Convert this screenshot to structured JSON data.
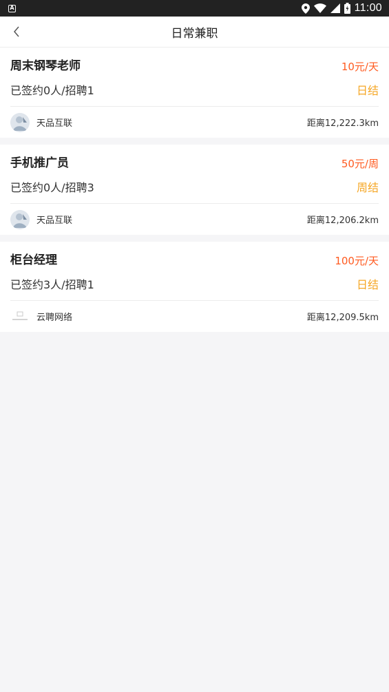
{
  "status_bar": {
    "time": "11:00",
    "left_icon": "a-notification-icon",
    "icons": [
      "location-icon",
      "wifi-icon",
      "signal-icon",
      "battery-icon"
    ]
  },
  "nav": {
    "title": "日常兼职",
    "back_icon": "chevron-left-icon"
  },
  "jobs": [
    {
      "title": "周末钢琴老师",
      "pay": "10元/天",
      "signed": "已签约0人/招聘1",
      "settle": "日结",
      "company": "天品互联",
      "distance": "距离12,222.3km"
    },
    {
      "title": "手机推广员",
      "pay": "50元/周",
      "signed": "已签约0人/招聘3",
      "settle": "周结",
      "company": "天品互联",
      "distance": "距离12,206.2km"
    },
    {
      "title": "柜台经理",
      "pay": "100元/天",
      "signed": "已签约3人/招聘1",
      "settle": "日结",
      "company": "云聘网络",
      "distance": "距离12,209.5km"
    }
  ],
  "colors": {
    "pay": "#ff5a1f",
    "settle": "#f5a623",
    "status_bar": "#222222",
    "background": "#f5f5f7"
  }
}
